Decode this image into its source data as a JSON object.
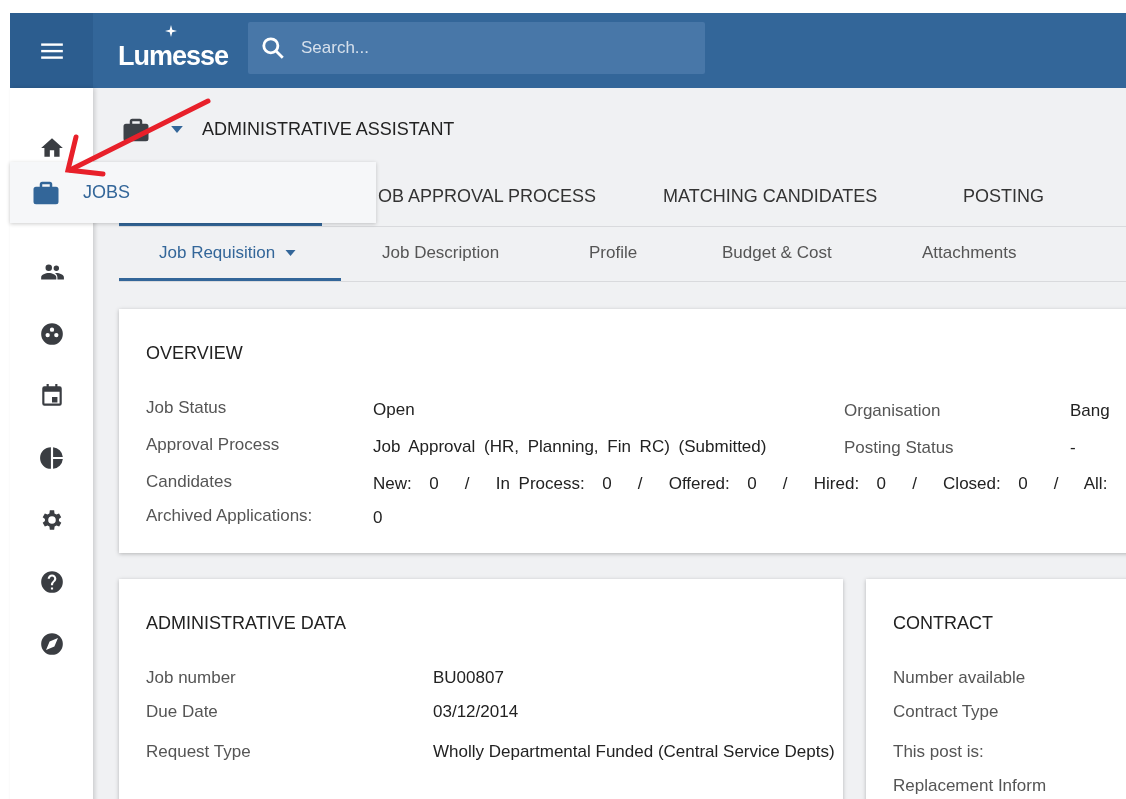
{
  "header": {
    "logo": "Lumesse",
    "search": {
      "placeholder": "Search..."
    }
  },
  "sidebar": {
    "items": [
      {
        "kind": "home"
      },
      {
        "kind": "people"
      },
      {
        "kind": "dots"
      },
      {
        "kind": "calendar"
      },
      {
        "kind": "pie"
      },
      {
        "kind": "gear"
      },
      {
        "kind": "help"
      },
      {
        "kind": "compass"
      }
    ]
  },
  "flyout": {
    "label": "JOBS"
  },
  "page_title": "ADMINISTRATIVE ASSISTANT",
  "tabs": [
    {
      "selected": true
    },
    {
      "label": "OB APPROVAL PROCESS",
      "selected": false
    },
    {
      "label": "MATCHING CANDIDATES",
      "selected": false
    },
    {
      "label": "POSTING",
      "selected": false
    }
  ],
  "subtabs": [
    {
      "label": "Job Requisition",
      "dropdown": true,
      "selected": true
    },
    {
      "label": "Job Description",
      "dropdown": false,
      "selected": false
    },
    {
      "label": "Profile",
      "dropdown": false,
      "selected": false
    },
    {
      "label": "Budget & Cost",
      "dropdown": false,
      "selected": false
    },
    {
      "label": "Attachments",
      "dropdown": false,
      "selected": false
    }
  ],
  "overview": {
    "title": "OVERVIEW",
    "rows": [
      {
        "label": "Job Status",
        "value": "Open",
        "label_2": "Organisation",
        "value_2": "Bang"
      },
      {
        "label": "Approval Process",
        "value": "Job Approval (HR, Planning, Fin RC) (Submitted)",
        "label_2": "Posting Status",
        "value_2": "-"
      },
      {
        "label": "Candidates",
        "value": "New:  0   /   In Process:  0   /   Offered:  0   /   Hired:  0   /   Closed:  0   /   All:"
      },
      {
        "label": "Archived Applications:",
        "value": "0"
      }
    ]
  },
  "administrative_data": {
    "title": "ADMINISTRATIVE DATA",
    "rows": [
      {
        "label": "Job number",
        "value": "BU00807"
      },
      {
        "label": "Due Date",
        "value": "03/12/2014"
      },
      {
        "label": "Request Type",
        "value": "Wholly Departmental Funded (Central Service Depts)"
      }
    ]
  },
  "contract": {
    "title": "CONTRACT",
    "rows": [
      {
        "label": "Number available"
      },
      {
        "label": "Contract Type"
      },
      {
        "label": "This post is:"
      },
      {
        "label": "Replacement Inform"
      }
    ]
  }
}
